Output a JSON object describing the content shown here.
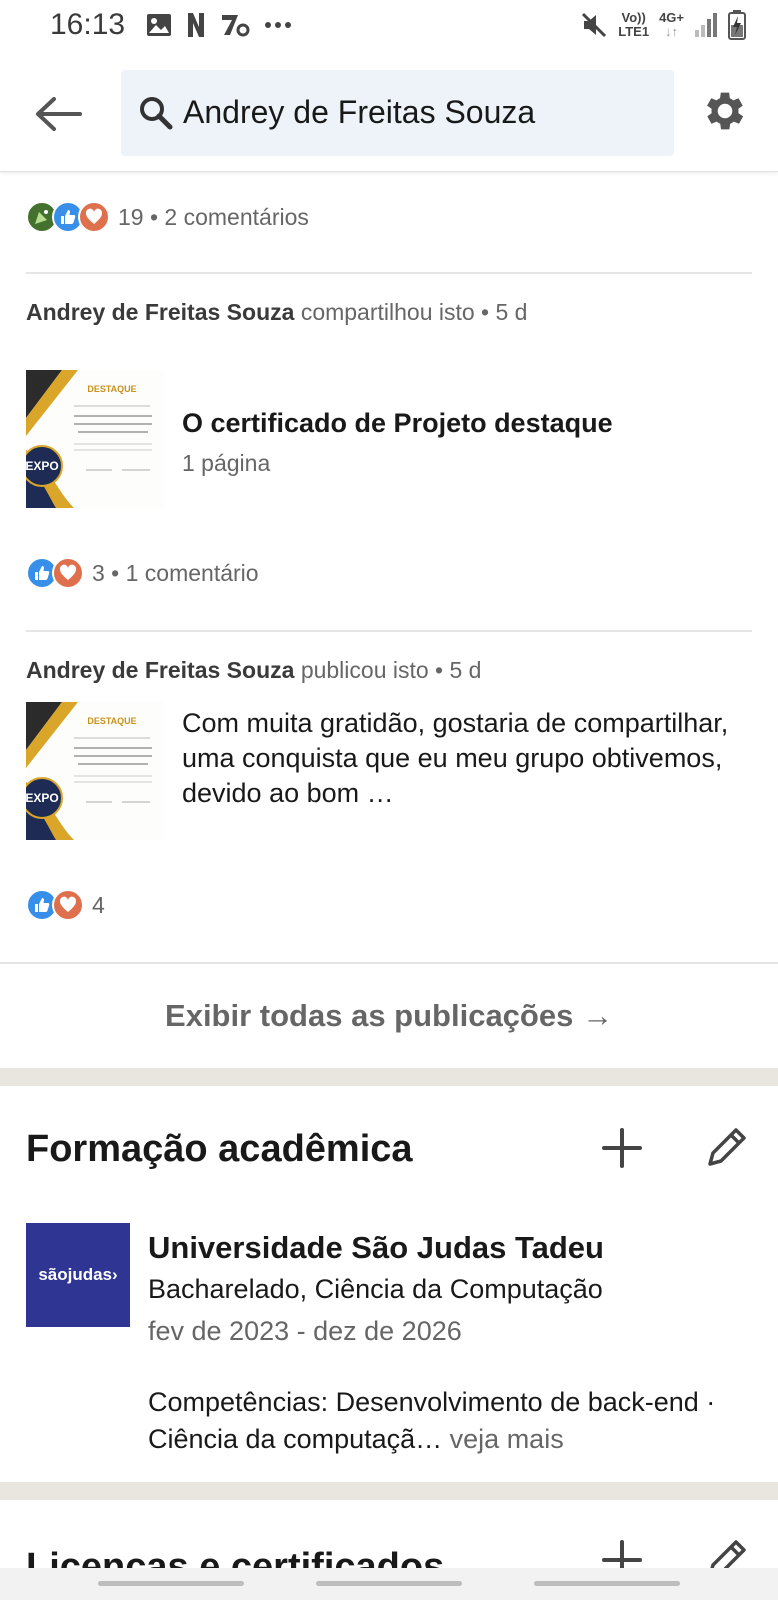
{
  "status_bar": {
    "time": "16:13",
    "left_icons": [
      "image-icon",
      "netflix-icon",
      "app-icon",
      "more-dots-icon"
    ],
    "network_label_top": "Vo))",
    "network_label_bottom": "LTE1",
    "data_label": "4G+",
    "right_icons": [
      "mute-icon",
      "signal-icon",
      "battery-charging-icon"
    ]
  },
  "search": {
    "query": "Andrey de Freitas Souza"
  },
  "posts": [
    {
      "reactions_icons": [
        "celebrate-icon",
        "like-icon",
        "love-icon"
      ],
      "reactions_text": "19 • 2 comentários"
    },
    {
      "author": "Andrey de Freitas Souza",
      "action": "compartilhou isto • 5 d",
      "doc_title": "O certificado de Projeto destaque",
      "doc_pages": "1 página",
      "reactions_icons": [
        "like-icon",
        "love-icon"
      ],
      "reactions_text": "3 • 1 comentário"
    },
    {
      "author": "Andrey de Freitas Souza",
      "action": "publicou isto • 5 d",
      "text": "Com muita gratidão, gostaria de compartilhar, uma conquista que eu meu grupo obtivemos, devido ao bom …",
      "reactions_icons": [
        "like-icon",
        "love-icon"
      ],
      "reactions_text": "4"
    }
  ],
  "certificate": {
    "heading": "DESTAQUE",
    "badge": "EXPO"
  },
  "show_all": "Exibir todas as publicações →",
  "education": {
    "title": "Formação acadêmica",
    "school_logo": "sãojudas›",
    "school": "Universidade São Judas Tadeu",
    "degree": "Bacharelado, Ciência da Computação",
    "dates": "fev de 2023 - dez de 2026",
    "skills": "Competências: Desenvolvimento de back-end · Ciência da computaçã…",
    "see_more": " veja mais"
  },
  "licenses": {
    "title": "Licenças e certificados"
  },
  "colors": {
    "like": "#378fe9",
    "love": "#df704d",
    "celebrate": "#44712e",
    "logo_bg": "#2e3592",
    "band": "#e9e5df"
  }
}
